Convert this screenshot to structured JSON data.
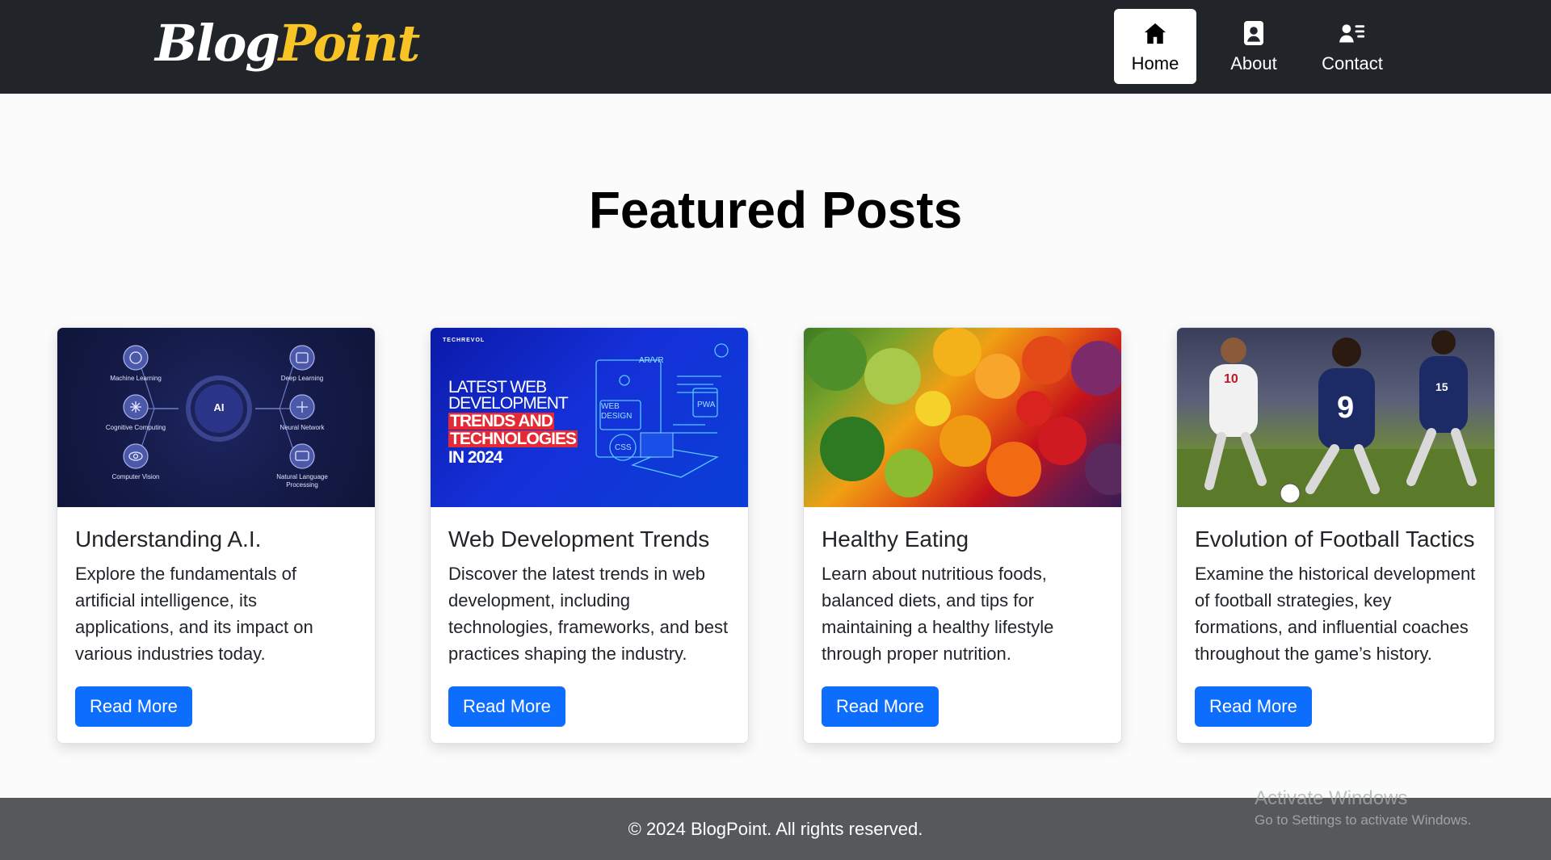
{
  "brand": {
    "part1": "Blog",
    "part2": "Point"
  },
  "nav": [
    {
      "label": "Home",
      "icon": "home-icon",
      "active": true
    },
    {
      "label": "About",
      "icon": "person-badge-icon",
      "active": false
    },
    {
      "label": "Contact",
      "icon": "person-lines-icon",
      "active": false
    }
  ],
  "main": {
    "title": "Featured Posts"
  },
  "cards": [
    {
      "title": "Understanding A.I.",
      "text": "Explore the fundamentals of artificial intelligence, its applications, and its impact on various industries today.",
      "button": "Read More",
      "image": {
        "center": "AI",
        "labels": [
          "Machine Learning",
          "Deep Learning",
          "Cognitive Computing",
          "Neural Network",
          "Computer Vision",
          "Natural Language Processing"
        ]
      }
    },
    {
      "title": "Web Development Trends",
      "text": "Discover the latest trends in web development, including technologies, frameworks, and best practices shaping the industry.",
      "button": "Read More",
      "image": {
        "brand": "TECHREVOL",
        "line1": "LATEST WEB",
        "line2": "DEVELOPMENT",
        "line3": "TRENDS AND",
        "line4": "TECHNOLOGIES",
        "line5": "IN 2024",
        "tags": [
          "AR/VR",
          "WEB DESIGN",
          "PWA",
          "CSS"
        ]
      }
    },
    {
      "title": "Healthy Eating",
      "text": "Learn about nutritious foods, balanced diets, and tips for maintaining a healthy lifestyle through proper nutrition.",
      "button": "Read More",
      "image": {}
    },
    {
      "title": "Evolution of Football Tactics",
      "text": "Examine the historical development of football strategies, key formations, and influential coaches throughout the game’s history.",
      "button": "Read More",
      "image": {
        "jersey_numbers": [
          "10",
          "9",
          "15"
        ]
      }
    }
  ],
  "footer": {
    "copyright": "© 2024 BlogPoint. All rights reserved."
  },
  "watermark": {
    "title": "Activate Windows",
    "subtitle": "Go to Settings to activate Windows."
  },
  "colors": {
    "navbar": "#212529",
    "brand_accent": "#f7c325",
    "primary": "#0d6efd",
    "footer": "#55595c"
  }
}
